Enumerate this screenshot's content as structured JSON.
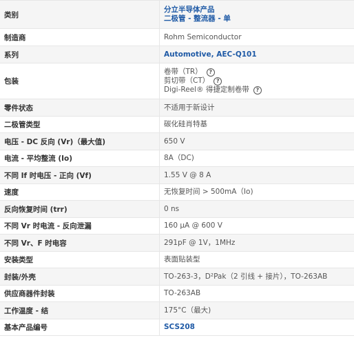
{
  "rows": [
    {
      "label": "类别",
      "values": [
        "分立半导体产品",
        "二极管 - 整流器 - 单"
      ],
      "link": true
    },
    {
      "label": "制造商",
      "values": [
        "Rohm Semiconductor"
      ]
    },
    {
      "label": "系列",
      "values": [
        "Automotive, AEC-Q101"
      ],
      "link": true
    },
    {
      "label": "包装",
      "values": [
        "卷带（TR）",
        "剪切带（CT）",
        "Digi-Reel® 得捷定制卷带"
      ],
      "help": true
    },
    {
      "label": "零件状态",
      "values": [
        "不适用于新设计"
      ]
    },
    {
      "label": "二极管类型",
      "values": [
        "碳化硅肖特基"
      ]
    },
    {
      "label": "电压 - DC 反向 (Vr)（最大值)",
      "values": [
        "650 V"
      ]
    },
    {
      "label": "电流 - 平均整流 (Io)",
      "values": [
        "8A（DC)"
      ]
    },
    {
      "label": "不同 If 时电压 - 正向 (Vf)",
      "values": [
        "1.55 V @ 8 A"
      ]
    },
    {
      "label": "速度",
      "values": [
        "无恢复时间 > 500mA（Io)"
      ]
    },
    {
      "label": "反向恢复时间 (trr)",
      "values": [
        "0 ns"
      ]
    },
    {
      "label": "不同 Vr 时电流 - 反向泄漏",
      "values": [
        "160 µA @ 600 V"
      ]
    },
    {
      "label": "不同 Vr、F 时电容",
      "values": [
        "291pF @ 1V，1MHz"
      ]
    },
    {
      "label": "安装类型",
      "values": [
        "表面贴装型"
      ]
    },
    {
      "label": "封装/外壳",
      "values": [
        "TO-263-3，D²Pak（2 引线 + 接片），TO-263AB"
      ]
    },
    {
      "label": "供应商器件封装",
      "values": [
        "TO-263AB"
      ]
    },
    {
      "label": "工作温度 - 结",
      "values": [
        "175°C（最大)"
      ]
    },
    {
      "label": "基本产品编号",
      "values": [
        "SCS208"
      ],
      "link": true
    }
  ],
  "help_glyph": "?"
}
